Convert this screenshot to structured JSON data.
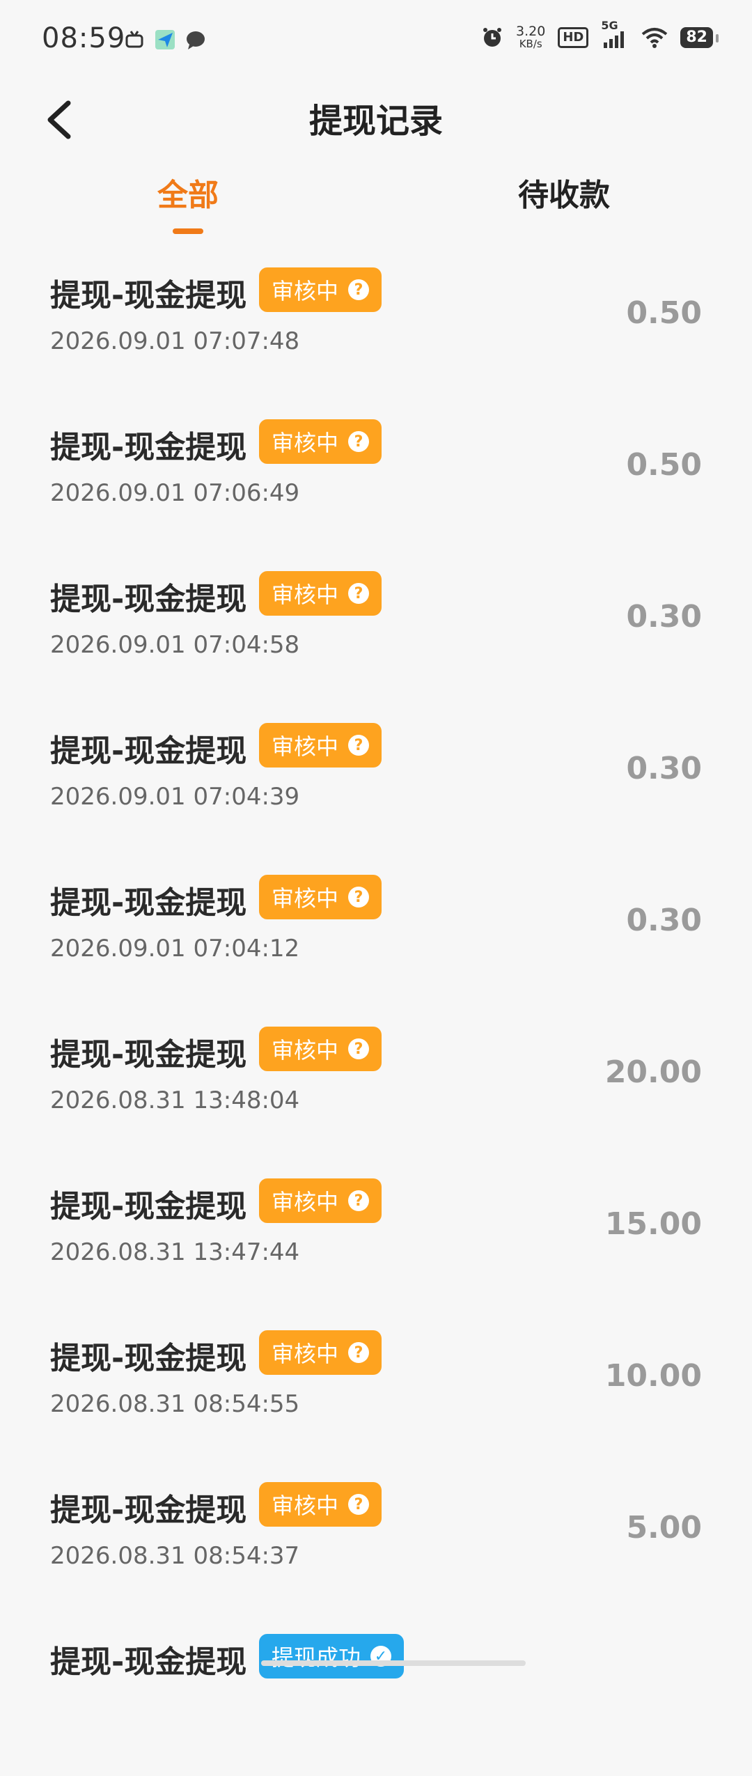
{
  "status_bar": {
    "time": "08:59",
    "net_speed_value": "3.20",
    "net_speed_unit": "KB/s",
    "hd_label": "HD",
    "network_label": "5G",
    "battery": "82"
  },
  "header": {
    "title": "提现记录"
  },
  "tabs": [
    {
      "label": "全部",
      "active": true
    },
    {
      "label": "待收款",
      "active": false
    }
  ],
  "records": [
    {
      "title": "提现-现金提现",
      "status": "审核中",
      "time": "2026.09.01 07:07:48",
      "amount": "0.50"
    },
    {
      "title": "提现-现金提现",
      "status": "审核中",
      "time": "2026.09.01 07:06:49",
      "amount": "0.50"
    },
    {
      "title": "提现-现金提现",
      "status": "审核中",
      "time": "2026.09.01 07:04:58",
      "amount": "0.30"
    },
    {
      "title": "提现-现金提现",
      "status": "审核中",
      "time": "2026.09.01 07:04:39",
      "amount": "0.30"
    },
    {
      "title": "提现-现金提现",
      "status": "审核中",
      "time": "2026.09.01 07:04:12",
      "amount": "0.30"
    },
    {
      "title": "提现-现金提现",
      "status": "审核中",
      "time": "2026.08.31 13:48:04",
      "amount": "20.00"
    },
    {
      "title": "提现-现金提现",
      "status": "审核中",
      "time": "2026.08.31 13:47:44",
      "amount": "15.00"
    },
    {
      "title": "提现-现金提现",
      "status": "审核中",
      "time": "2026.08.31 08:54:55",
      "amount": "10.00"
    },
    {
      "title": "提现-现金提现",
      "status": "审核中",
      "time": "2026.08.31 08:54:37",
      "amount": "5.00"
    },
    {
      "title": "提现-现金提现",
      "status": "提现成功",
      "time": "",
      "amount": ""
    }
  ],
  "colors": {
    "accent": "#f07a18",
    "review_badge": "#fea31f",
    "success_badge": "#26a8ec",
    "amount": "#9a9a9a"
  }
}
